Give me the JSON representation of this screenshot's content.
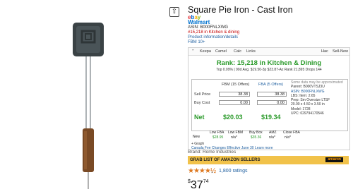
{
  "product": {
    "title": "Square Pie Iron - Cast Iron",
    "brand": "Brand: Rome Industries",
    "price_symbol": "$",
    "price_whole": "37",
    "price_cents": "74",
    "stars": "★★★★½",
    "ratings": "1,800 ratings"
  },
  "left_info": {
    "ebay": [
      "e",
      "b",
      "a",
      "y"
    ],
    "walmart": "Walmart",
    "asin": "ASIN: B000FNLXWG",
    "rank_line": "#15,218 in Kitchen & dining",
    "product_info": "Product information/details",
    "fbm": "FBM 10+"
  },
  "tabs": [
    "Keepa",
    "Camel",
    "Calc",
    "Links",
    "Hac",
    "Sell-New"
  ],
  "rank": {
    "label": "Rank:",
    "value": "15,218 in Kitchen & Dining",
    "line": "Top 0.09% | 90d Avg. $19.50-3p $23.87-Az Rank 21,895 Drops 144"
  },
  "calc": {
    "fbm_header": "FBM (15 Offers)",
    "fba_header": "FBA (5 Offers)",
    "sell_price_label": "Sell Price",
    "buy_cost_label": "Buy Cost",
    "sell_fbm": "38.38",
    "sell_fba": "38.38",
    "buy_fbm": "0.00",
    "buy_fba": "0.00",
    "net_label": "Net",
    "net_fbm": "$20.03",
    "net_fba": "$19.34",
    "right": [
      "Some data may be approximated",
      "Parent: B000VTSJ3U",
      "ASIN: B000FNLXWG",
      "LBS: Item: 2.65",
      "Prep: Sm Oversize LTSF",
      "20.00 x 4.50 x 3.50 in",
      "Model: 1728",
      "UPC: 029794170546"
    ]
  },
  "bottom": {
    "new": "New",
    "low_fba": "Low FBA",
    "low_fba_val": "$28.95",
    "low_fbm": "Low FBM",
    "low_fbm_val": "n/a*",
    "buy_box": "Buy Box",
    "buy_box_val": "$35.36",
    "amz": "AMZ",
    "amz_val": "n/a*",
    "close_fba": "Close FBA",
    "close_fba_val": "n/a*",
    "graph": "+ Graph",
    "canada": "Canada Fee Changes Effective June 30",
    "learn_more": "Learn more"
  },
  "banner": {
    "text": "GRAB LIST OF AMAZON SELLERS",
    "badge": "amazon"
  }
}
